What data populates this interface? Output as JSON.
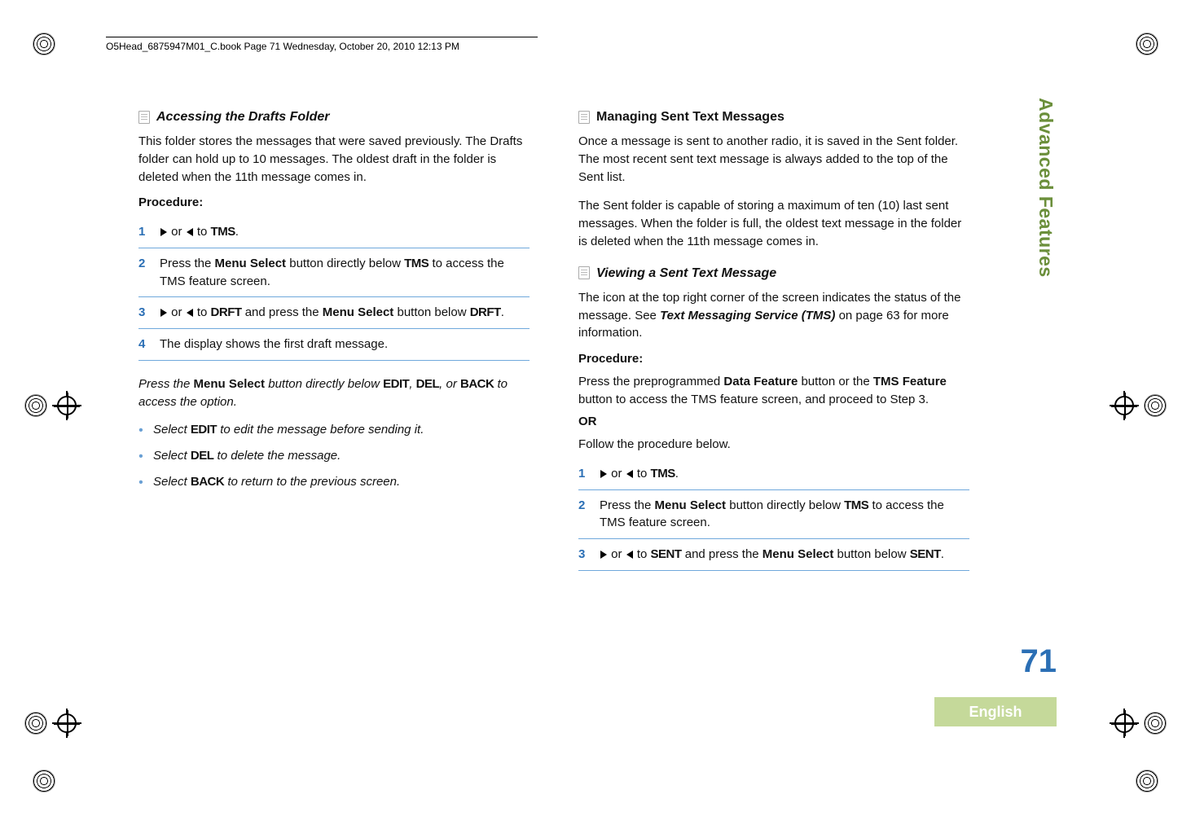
{
  "header_line": "O5Head_6875947M01_C.book  Page 71  Wednesday, October 20, 2010  12:13 PM",
  "side_tab": "Advanced Features",
  "page_number": "71",
  "language_tab": "English",
  "left": {
    "h1": "Accessing the Drafts Folder",
    "intro": "This folder stores the messages that were saved previously. The Drafts folder can hold up to 10 messages. The oldest draft in the folder is deleted when the 11th message comes in.",
    "procedure_label": "Procedure:",
    "steps": {
      "s1_a": " or ",
      "s1_b": " to ",
      "s1_c": "TMS",
      "s1_d": ".",
      "s2_a": "Press the ",
      "s2_b": "Menu Select",
      "s2_c": " button directly below ",
      "s2_d": "TMS",
      "s2_e": " to access the TMS feature screen.",
      "s3_a": " or ",
      "s3_b": " to ",
      "s3_c": "DRFT",
      "s3_d": " and press the ",
      "s3_e": "Menu Select",
      "s3_f": " button below ",
      "s3_g": "DRFT",
      "s3_h": ".",
      "s4": "The display shows the first draft message."
    },
    "after_a": "Press the ",
    "after_b": "Menu Select",
    "after_c": " button directly below ",
    "after_d": "EDIT",
    "after_e": ", ",
    "after_f": "DEL",
    "after_g": ", or ",
    "after_h": "BACK",
    "after_i": " to access the option.",
    "bullets": {
      "b1_a": "Select ",
      "b1_b": "EDIT",
      "b1_c": " to edit the message before sending it.",
      "b2_a": "Select ",
      "b2_b": "DEL",
      "b2_c": " to delete the message.",
      "b3_a": "Select ",
      "b3_b": "BACK",
      "b3_c": " to return to the previous screen."
    }
  },
  "right": {
    "h1": "Managing Sent Text Messages",
    "p1": "Once a message is sent to another radio, it is saved in the Sent folder. The most recent sent text message is always added to the top of the Sent list.",
    "p2": "The Sent folder is capable of storing a maximum of ten (10) last sent messages. When the folder is full, the oldest text message in the folder is deleted when the 11th message comes in.",
    "h2": "Viewing a Sent Text Message",
    "p3_a": "The icon at the top right corner of the screen indicates the status of the message. See ",
    "p3_b": "Text Messaging Service (TMS)",
    "p3_c": " on page 63 for more information.",
    "procedure_label": "Procedure:",
    "pre_a": "Press the preprogrammed ",
    "pre_b": "Data Feature",
    "pre_c": " button or the ",
    "pre_d": "TMS Feature",
    "pre_e": " button to access the TMS feature screen, and proceed to Step 3.",
    "or": "OR",
    "follow": "Follow the procedure below.",
    "steps": {
      "s1_a": " or ",
      "s1_b": " to ",
      "s1_c": "TMS",
      "s1_d": ".",
      "s2_a": "Press the ",
      "s2_b": "Menu Select",
      "s2_c": " button directly below ",
      "s2_d": "TMS",
      "s2_e": " to access the TMS feature screen.",
      "s3_a": " or ",
      "s3_b": " to ",
      "s3_c": "SENT",
      "s3_d": " and press the ",
      "s3_e": "Menu Select",
      "s3_f": " button below ",
      "s3_g": "SENT",
      "s3_h": "."
    }
  }
}
